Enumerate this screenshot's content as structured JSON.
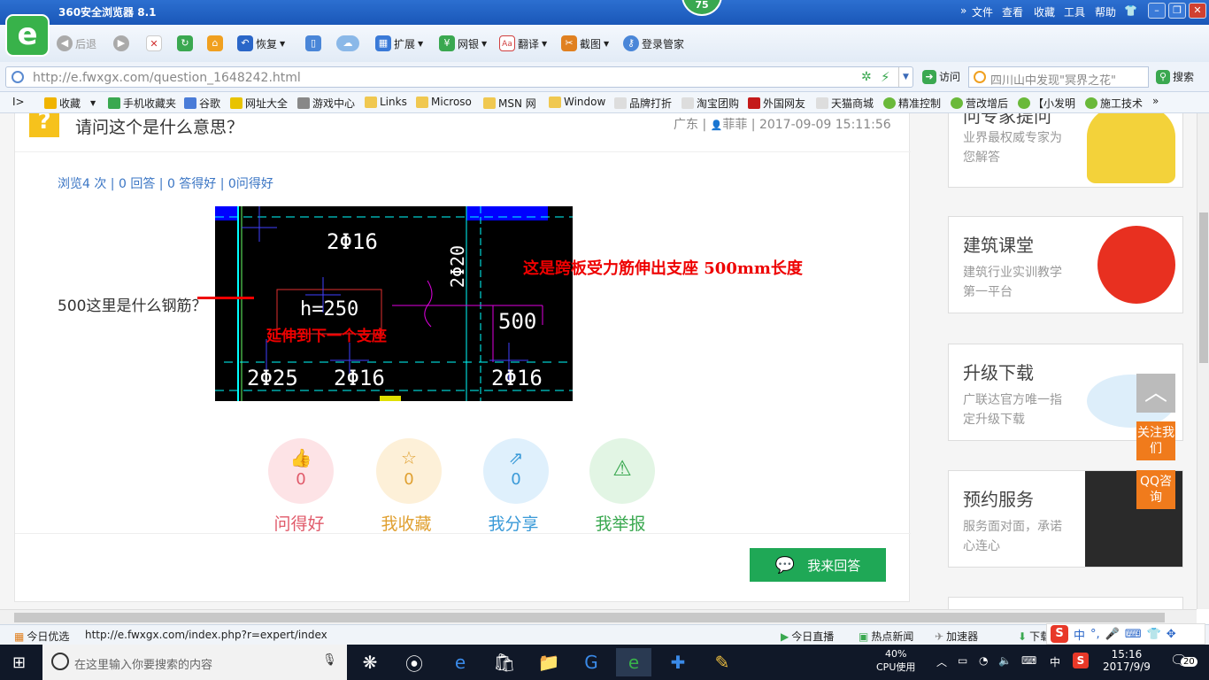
{
  "browser": {
    "title": "360安全浏览器 8.1",
    "badge": "75",
    "menu": [
      "文件",
      "查看",
      "收藏",
      "工具",
      "帮助"
    ],
    "logo_letter": "e"
  },
  "toolbar": {
    "back": "后退",
    "restore": "恢复",
    "extend": "扩展",
    "netbank": "网银",
    "translate": "翻译",
    "screenshot": "截图",
    "login": "登录管家"
  },
  "address": {
    "url": "http://e.fwxgx.com/question_1648242.html",
    "go": "访问",
    "search_placeholder": "四川山中发现\"冥界之花\"",
    "search_button": "搜索"
  },
  "favorites": [
    {
      "label": "收藏",
      "color": "#f0b400"
    },
    {
      "label": "手机收藏夹",
      "color": "#3aa850"
    },
    {
      "label": "谷歌",
      "color": "#4a7cd8"
    },
    {
      "label": "网址大全",
      "color": "#e8c300"
    },
    {
      "label": "游戏中心",
      "color": "#888888"
    },
    {
      "label": "Links",
      "color": "#f0c850"
    },
    {
      "label": "Microso",
      "color": "#f0c850"
    },
    {
      "label": "MSN 网",
      "color": "#f0c850"
    },
    {
      "label": "Window",
      "color": "#f0c850"
    },
    {
      "label": "品牌打折",
      "color": "#dddddd"
    },
    {
      "label": "淘宝团购",
      "color": "#dddddd"
    },
    {
      "label": "外国网友",
      "color": "#c41a1a"
    },
    {
      "label": "天猫商城",
      "color": "#dddddd"
    },
    {
      "label": "精准控制",
      "color": "#6ab93a"
    },
    {
      "label": "营改增后",
      "color": "#6ab93a"
    },
    {
      "label": "【小发明",
      "color": "#6ab93a"
    },
    {
      "label": "施工技术",
      "color": "#6ab93a"
    }
  ],
  "question": {
    "title": "请问这个是什么意思？",
    "meta_region": "广东 |",
    "meta_user": "菲菲",
    "meta_time": "| 2017-09-09 15:11:56",
    "stats": "浏览4 次 | 0 回答 | 0 答得好 | 0问得好",
    "text": "500这里是什么钢筋？",
    "image_labels": {
      "top": "2Φ16",
      "vertical": "2Φ20",
      "h": "h=250",
      "num": "500",
      "b1": "2Φ25",
      "b2": "2Φ16",
      "b3": "2Φ16",
      "red1": "延伸到下一个支座"
    },
    "annotation": "这是跨板受力筋伸出支座 500mm长度"
  },
  "actions": [
    {
      "label": "问得好",
      "count": "0",
      "icon": "thumbs-up",
      "color": "#e05a6a",
      "bg": "#fde3e6"
    },
    {
      "label": "我收藏",
      "count": "0",
      "icon": "star",
      "color": "#e0a030",
      "bg": "#fdf0d8"
    },
    {
      "label": "我分享",
      "count": "0",
      "icon": "share",
      "color": "#3a9ad8",
      "bg": "#dff0fc"
    },
    {
      "label": "我举报",
      "count": "",
      "icon": "warning",
      "color": "#3aa850",
      "bg": "#e2f5e4"
    }
  ],
  "answer_button": "我来回答",
  "sidebar": [
    {
      "title": "问专家提问",
      "desc": "业界最权威专家为您解答"
    },
    {
      "title": "建筑课堂",
      "desc": "建筑行业实训教学第一平台"
    },
    {
      "title": "升级下载",
      "desc": "广联达官方唯一指定升级下载"
    },
    {
      "title": "预约服务",
      "desc": "服务面对面，承诺心连心"
    }
  ],
  "float": {
    "follow": "关注我们",
    "qq": "QQ咨询"
  },
  "status": {
    "left": "今日优选",
    "url": "http://e.fwxgx.com/index.php?r=expert/index",
    "live": "今日直播",
    "news": "热点新闻",
    "speed": "加速器",
    "download": "下载"
  },
  "taskbar": {
    "search": "在这里输入你要搜索的内容",
    "cpu_percent": "40%",
    "cpu_label": "CPU使用",
    "ime": "中",
    "time": "15:16",
    "date": "2017/9/9",
    "notifications": "20"
  }
}
